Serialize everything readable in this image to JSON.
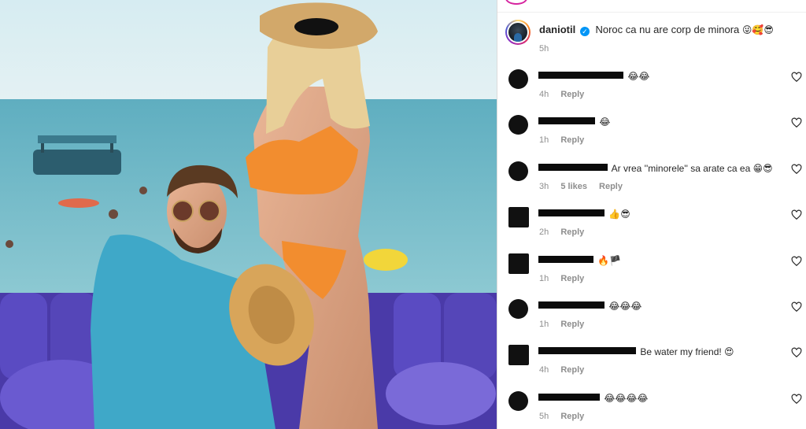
{
  "caption": {
    "username": "daniotil",
    "verified_mark": "✓",
    "text": "Noroc ca nu are corp de minora",
    "emojis": "😜🥰😎",
    "time": "5h"
  },
  "labels": {
    "reply": "Reply"
  },
  "comments": [
    {
      "text_after": "😂😂",
      "time": "4h",
      "likes": ""
    },
    {
      "text_after": "😂",
      "time": "1h",
      "likes": ""
    },
    {
      "text_after": "Ar vrea ''minorele'' sa arate ca ea 😁😎",
      "time": "3h",
      "likes": "5 likes"
    },
    {
      "text_after": "👍😎",
      "time": "2h",
      "likes": ""
    },
    {
      "text_after": "🔥🏴",
      "time": "1h",
      "likes": ""
    },
    {
      "text_after": "😂😂😂",
      "time": "1h",
      "likes": ""
    },
    {
      "text_after": "Be water my friend! 😍",
      "time": "4h",
      "likes": ""
    },
    {
      "text_after": "😂😂😂😂",
      "time": "5h",
      "likes": ""
    }
  ],
  "icons": {
    "post_image": "beach-photo",
    "like": "heart-icon",
    "verified": "verified-badge-icon"
  },
  "colors": {
    "verified_blue": "#0095f6",
    "muted": "#8e8e8e",
    "border": "#dbdbdb"
  }
}
